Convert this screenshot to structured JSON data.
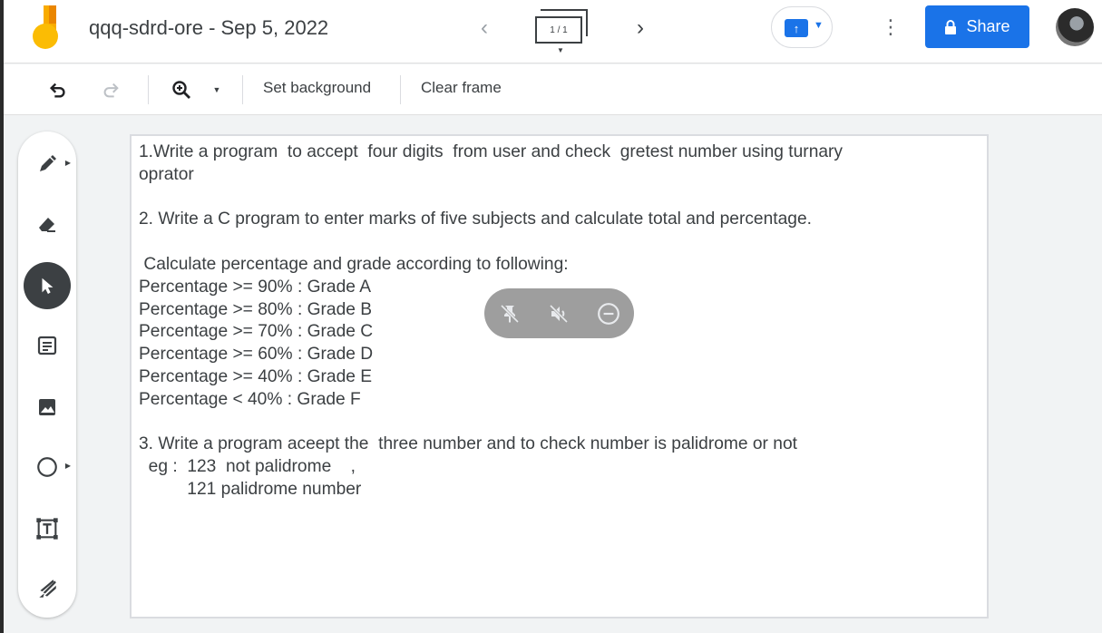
{
  "app": {
    "title": "qqq-sdrd-ore - Sep 5, 2022",
    "frame_counter": "1 / 1",
    "share_label": "Share"
  },
  "toolbar": {
    "set_background": "Set background",
    "clear_frame": "Clear frame"
  },
  "tools": [
    "pen-tool",
    "eraser-tool",
    "select-tool",
    "sticky-note-tool",
    "add-image-tool",
    "circle-tool",
    "text-box-tool",
    "laser-tool"
  ],
  "canvas": {
    "lines": [
      "1.Write a program  to accept  four digits  from user and check  gretest number using turnary",
      "oprator",
      "",
      "2. Write a C program to enter marks of five subjects and calculate total and percentage.",
      "",
      " Calculate percentage and grade according to following:",
      "Percentage >= 90% : Grade A",
      "Percentage >= 80% : Grade B",
      "Percentage >= 70% : Grade C",
      "Percentage >= 60% : Grade D",
      "Percentage >= 40% : Grade E",
      "Percentage < 40% : Grade F",
      "",
      "3. Write a program aceept the  three number and to check number is palidrome or not",
      "  eg :  123  not palidrome    ,",
      "          121 palidrome number"
    ]
  },
  "colors": {
    "accent": "#1a73e8",
    "text": "#3c4043",
    "overlay": "#9e9e9e"
  }
}
